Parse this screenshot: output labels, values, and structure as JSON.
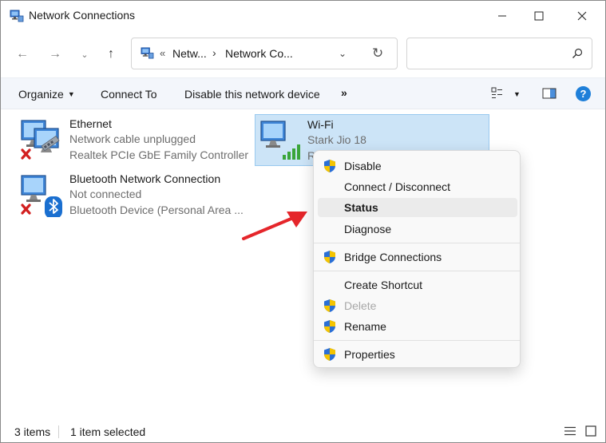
{
  "window": {
    "title": "Network Connections",
    "controls": {
      "minimize": "—",
      "maximize": "☐",
      "close": "✕"
    }
  },
  "nav": {
    "back_glyph": "←",
    "forward_glyph": "→",
    "recent_glyph": "⌄",
    "up_glyph": "↑",
    "address": {
      "overflow": "«",
      "crumb1": "Netw...",
      "separator": "›",
      "crumb2": "Network Co...",
      "dropdown_glyph": "⌄",
      "refresh_glyph": "↻"
    },
    "search": {
      "value": "",
      "placeholder": ""
    }
  },
  "command_bar": {
    "organize": "Organize",
    "organize_caret": "▼",
    "connect_to": "Connect To",
    "disable_device": "Disable this network device",
    "more": "»",
    "view_caret": "▼",
    "help": "?"
  },
  "items": [
    {
      "name": "Ethernet",
      "status": "Network cable unplugged",
      "device": "Realtek PCIe GbE Family Controller"
    },
    {
      "name": "Wi-Fi",
      "status": "Stark Jio 18",
      "device": "R"
    },
    {
      "name": "Bluetooth Network Connection",
      "status": "Not connected",
      "device": "Bluetooth Device (Personal Area ..."
    }
  ],
  "context_menu": {
    "items": [
      {
        "label": "Disable",
        "shield": true
      },
      {
        "label": "Connect / Disconnect",
        "shield": false
      },
      {
        "label": "Status",
        "shield": false,
        "highlighted": true
      },
      {
        "label": "Diagnose",
        "shield": false
      },
      {
        "label": "Bridge Connections",
        "shield": true
      },
      {
        "label": "Create Shortcut",
        "shield": false
      },
      {
        "label": "Delete",
        "shield": true,
        "disabled": true
      },
      {
        "label": "Rename",
        "shield": true
      },
      {
        "label": "Properties",
        "shield": true
      }
    ]
  },
  "status_bar": {
    "count": "3 items",
    "selected": "1 item selected"
  },
  "colors": {
    "selection_bg": "#cce4f7",
    "selection_border": "#99c9ef",
    "annotation_arrow": "#e5262b",
    "help_blue": "#1e7fd9",
    "shield_blue": "#2a6fd6",
    "shield_yellow": "#f5c400"
  },
  "icons": {
    "title": "network-connections-icon",
    "search": "search-icon",
    "view": "change-view-icon",
    "preview_pane": "preview-pane-icon",
    "help": "help-icon",
    "ethernet": "ethernet-adapter-icon",
    "wifi": "wifi-adapter-icon",
    "bluetooth": "bluetooth-adapter-icon",
    "shield": "uac-shield-icon",
    "arrow": "red-arrow-annotation"
  }
}
